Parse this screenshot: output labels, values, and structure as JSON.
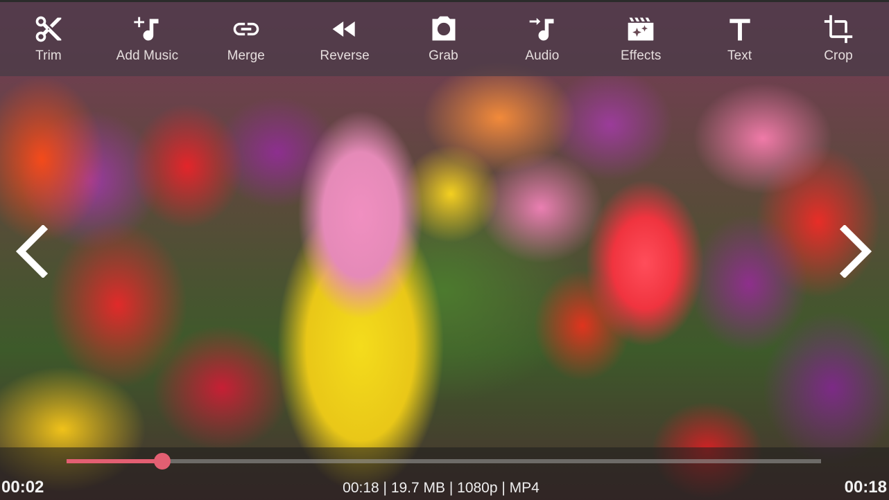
{
  "toolbar": {
    "items": [
      {
        "label": "Trim",
        "icon": "scissors-icon"
      },
      {
        "label": "Add Music",
        "icon": "add-music-icon"
      },
      {
        "label": "Merge",
        "icon": "link-icon"
      },
      {
        "label": "Reverse",
        "icon": "rewind-icon"
      },
      {
        "label": "Grab",
        "icon": "camera-icon"
      },
      {
        "label": "Audio",
        "icon": "audio-import-icon"
      },
      {
        "label": "Effects",
        "icon": "effects-clapper-icon"
      },
      {
        "label": "Text",
        "icon": "text-icon"
      },
      {
        "label": "Crop",
        "icon": "crop-icon"
      }
    ]
  },
  "navigation": {
    "prev_icon": "chevron-left-icon",
    "next_icon": "chevron-right-icon"
  },
  "player": {
    "current_time": "00:02",
    "duration": "00:18",
    "progress_fraction": 0.127,
    "accent_color": "#e35f72",
    "info": "00:18 | 19.7 MB | 1080p | MP4"
  }
}
